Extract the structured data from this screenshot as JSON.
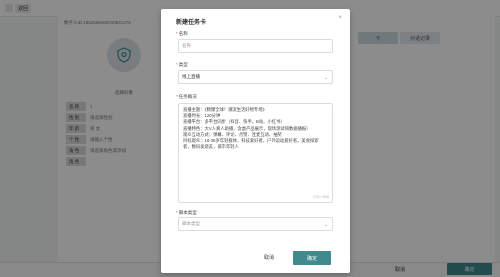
{
  "background": {
    "back_label": "返回",
    "id_line": "数字人ID:1952668450010841378",
    "avatar_label": "选择形象",
    "tabs": [
      {
        "label": "卡"
      },
      {
        "label": "对话记录"
      }
    ],
    "form_rows": [
      {
        "key": "名 称",
        "value": "1"
      },
      {
        "key": "性 别",
        "value": "请选择性别"
      },
      {
        "key": "年 龄",
        "value": "男   女"
      },
      {
        "key": "个 性",
        "value": "请输入个性"
      },
      {
        "key": "角 色",
        "value": "请选择角色或添加"
      },
      {
        "key": "角 色",
        "value": ""
      }
    ],
    "cancel_label": "取消",
    "ok_label": "确定"
  },
  "modal": {
    "title": "新建任务卡",
    "close_glyph": "×",
    "name_label": "名称",
    "name_placeholder": "名称",
    "type_label": "类型",
    "type_value": "线上直播",
    "overview_label": "任务概况",
    "overview_lines": [
      "直播主题：《精爆全球！潮流生活好物专场》",
      "直播时长：120分钟",
      "直播平台：多平台同步（抖音、快手、B站、小红书）",
      "直播特色：大V人真人助播，含虚产品展示，现场测试和数据播报）",
      "观众互动方式：弹幕、评论、点赞、连麦互动、抽奖",
      "目标观众：18-35岁年轻群体，科技爱好者，户外运动爱好者，美食探索",
      "者，数码发烧友，城市年轻人"
    ],
    "overview_counter": "170 / 500",
    "script_type_label": "脚本类型",
    "script_type_placeholder": "脚本类型",
    "cancel_label": "取消",
    "ok_label": "确定"
  },
  "colors": {
    "accent": "#3e8a8d",
    "required": "#d9534f"
  }
}
